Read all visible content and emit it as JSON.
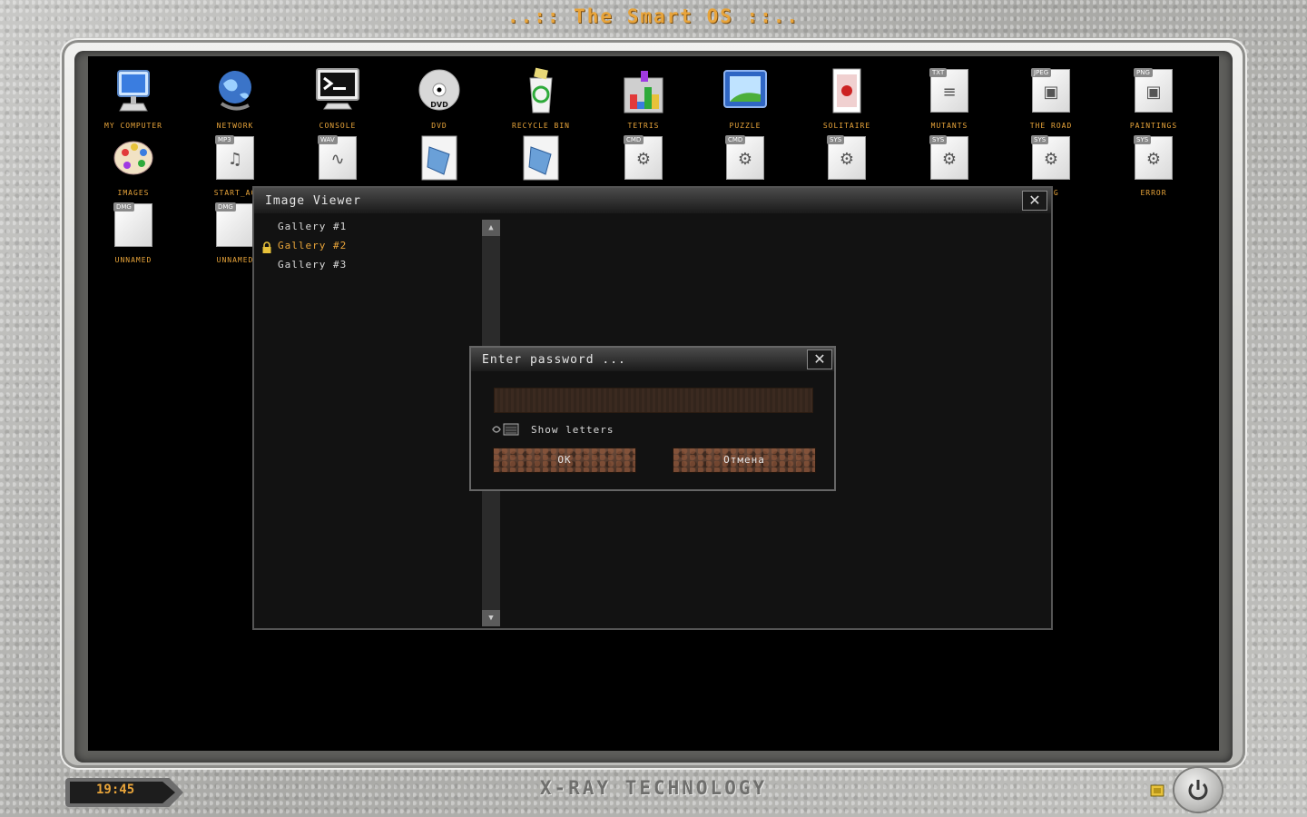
{
  "os": {
    "title": "..:: The Smart OS ::..",
    "brand": "X-RAY TECHNOLOGY",
    "clock": "19:45",
    "accent_color": "#e8a43a"
  },
  "desktop": {
    "row1": [
      {
        "label": "MY COMPUTER",
        "icon": "monitor-icon"
      },
      {
        "label": "NETWORK",
        "icon": "globe-icon"
      },
      {
        "label": "CONSOLE",
        "icon": "terminal-icon"
      },
      {
        "label": "DVD",
        "icon": "dvd-icon"
      },
      {
        "label": "RECYCLE BIN",
        "icon": "recycle-bin-icon"
      },
      {
        "label": "TETRIS",
        "icon": "tetris-icon"
      },
      {
        "label": "PUZZLE",
        "icon": "picture-icon"
      },
      {
        "label": "SOLITAIRE",
        "icon": "cards-icon"
      },
      {
        "label": "MUTANTS",
        "icon": "txt-file-icon",
        "tag": "TXT"
      },
      {
        "label": "THE ROAD",
        "icon": "jpeg-file-icon",
        "tag": "JPEG"
      },
      {
        "label": "PAINTINGS",
        "icon": "png-file-icon",
        "tag": "PNG"
      }
    ],
    "row2": [
      {
        "label": "IMAGES",
        "icon": "palette-icon"
      },
      {
        "label": "START_AG",
        "icon": "mp3-file-icon",
        "tag": "MP3"
      },
      {
        "label": "",
        "icon": "wav-file-icon",
        "tag": "WAV"
      },
      {
        "label": "",
        "icon": "video-file-icon"
      },
      {
        "label": "",
        "icon": "video-file-icon"
      },
      {
        "label": "",
        "icon": "cmd-file-icon",
        "tag": "CMD"
      },
      {
        "label": "",
        "icon": "cmd-file-icon",
        "tag": "CMD"
      },
      {
        "label": "",
        "icon": "sys-file-icon",
        "tag": "SYS"
      },
      {
        "label": "",
        "icon": "sys-file-icon",
        "tag": "SYS"
      },
      {
        "label": "FIG",
        "icon": "sys-file-icon",
        "tag": "SYS"
      },
      {
        "label": "ERROR",
        "icon": "sys-file-icon",
        "tag": "SYS"
      }
    ],
    "row3": [
      {
        "label": "UNNAMED",
        "icon": "dmg-file-icon",
        "tag": "DMG"
      },
      {
        "label": "UNNAMED",
        "icon": "dmg-file-icon",
        "tag": "DMG"
      }
    ]
  },
  "viewer": {
    "title": "Image Viewer",
    "close": "✕",
    "galleries": [
      "Gallery #1",
      "Gallery #2",
      "Gallery #3"
    ],
    "scroll_up": "▲",
    "scroll_down": "▼"
  },
  "dialog": {
    "title": "Enter password ...",
    "close": "✕",
    "password_value": "",
    "show_letters": "Show letters",
    "ok": "OK",
    "cancel": "Отмена"
  }
}
